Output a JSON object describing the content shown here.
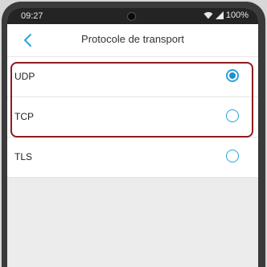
{
  "status_bar": {
    "time": "09:27",
    "battery": "100%"
  },
  "header": {
    "title": "Protocole de transport",
    "back_icon": "chevron-left-icon"
  },
  "options": [
    {
      "label": "UDP",
      "selected": true
    },
    {
      "label": "TCP",
      "selected": false
    },
    {
      "label": "TLS",
      "selected": false
    }
  ],
  "colors": {
    "accent": "#1a8fd6",
    "highlight": "#8c1c1c"
  }
}
